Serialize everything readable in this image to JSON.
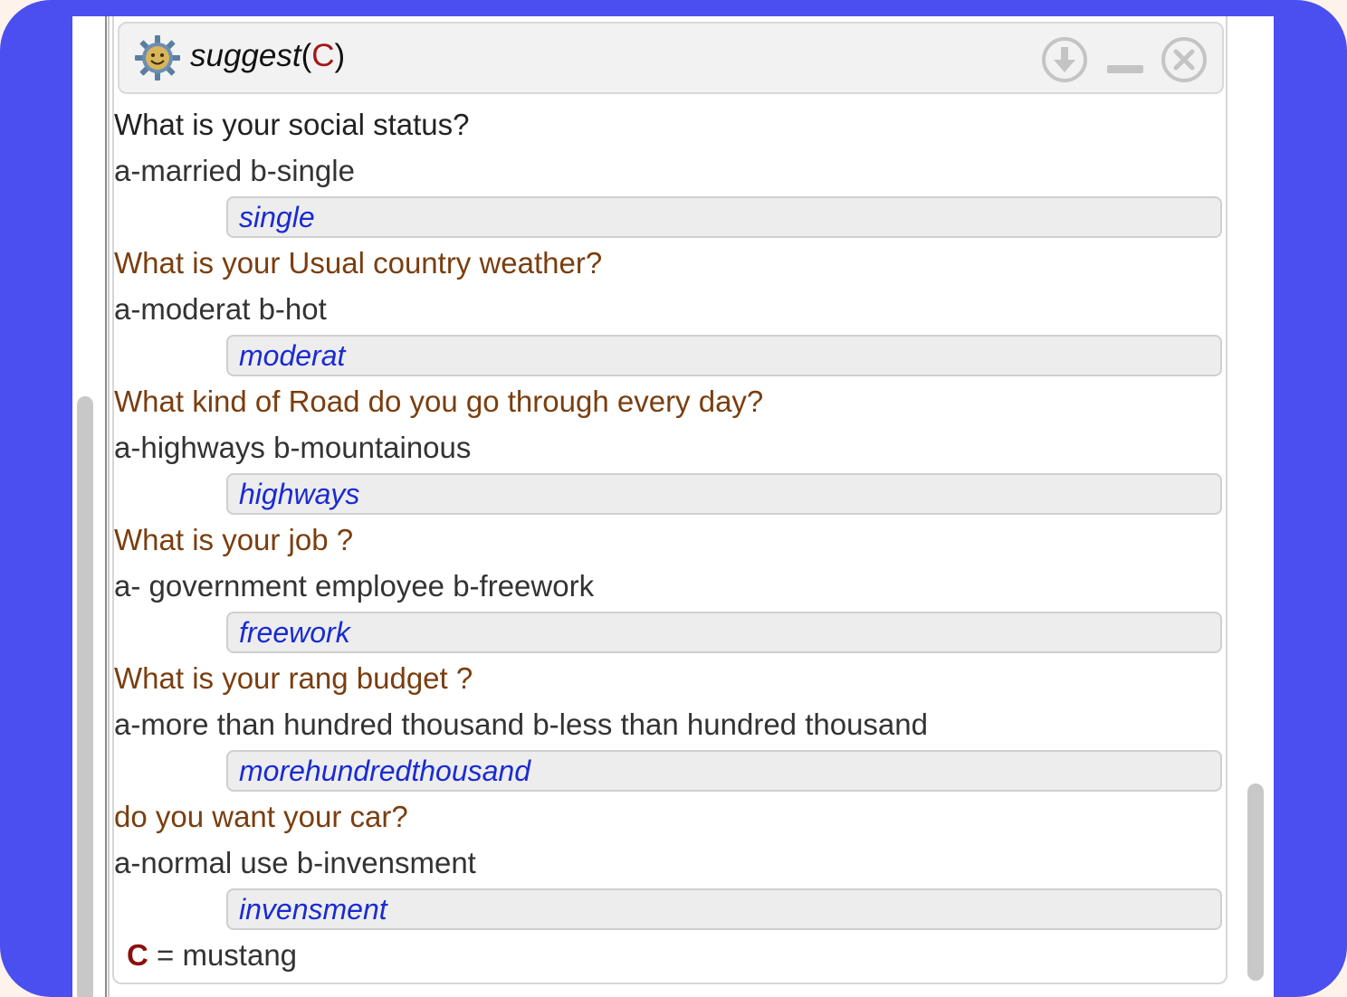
{
  "window": {
    "title_func": "suggest",
    "title_open": "(",
    "title_arg": "C",
    "title_close": ")"
  },
  "header_icons": [
    "gear-face-icon",
    "download-circle-icon",
    "minimize-icon",
    "close-circle-icon"
  ],
  "questions": [
    {
      "question": "What is your social status?",
      "options": "a-married b-single",
      "answer": "single"
    },
    {
      "question": "What is your Usual country weather?",
      "options": "a-moderat b-hot",
      "answer": "moderat"
    },
    {
      "question": "What kind of Road do you go through every day?",
      "options": "a-highways b-mountainous",
      "answer": "highways"
    },
    {
      "question": "What is your job ?",
      "options": "a- government employee b-freework",
      "answer": "freework"
    },
    {
      "question": "What is your rang budget ?",
      "options": "a-more than hundred thousand b-less than hundred thousand",
      "answer": "morehundredthousand"
    },
    {
      "question": "do you want your car?",
      "options": "a-normal use b-invensment",
      "answer": "invensment"
    }
  ],
  "result": {
    "variable": "C",
    "equals": " = ",
    "value": "mustang"
  },
  "colors": {
    "frame": "#4b4ff0",
    "question": "#7a3e0f",
    "answer": "#1a2bd1",
    "variable": "#8a1010"
  }
}
